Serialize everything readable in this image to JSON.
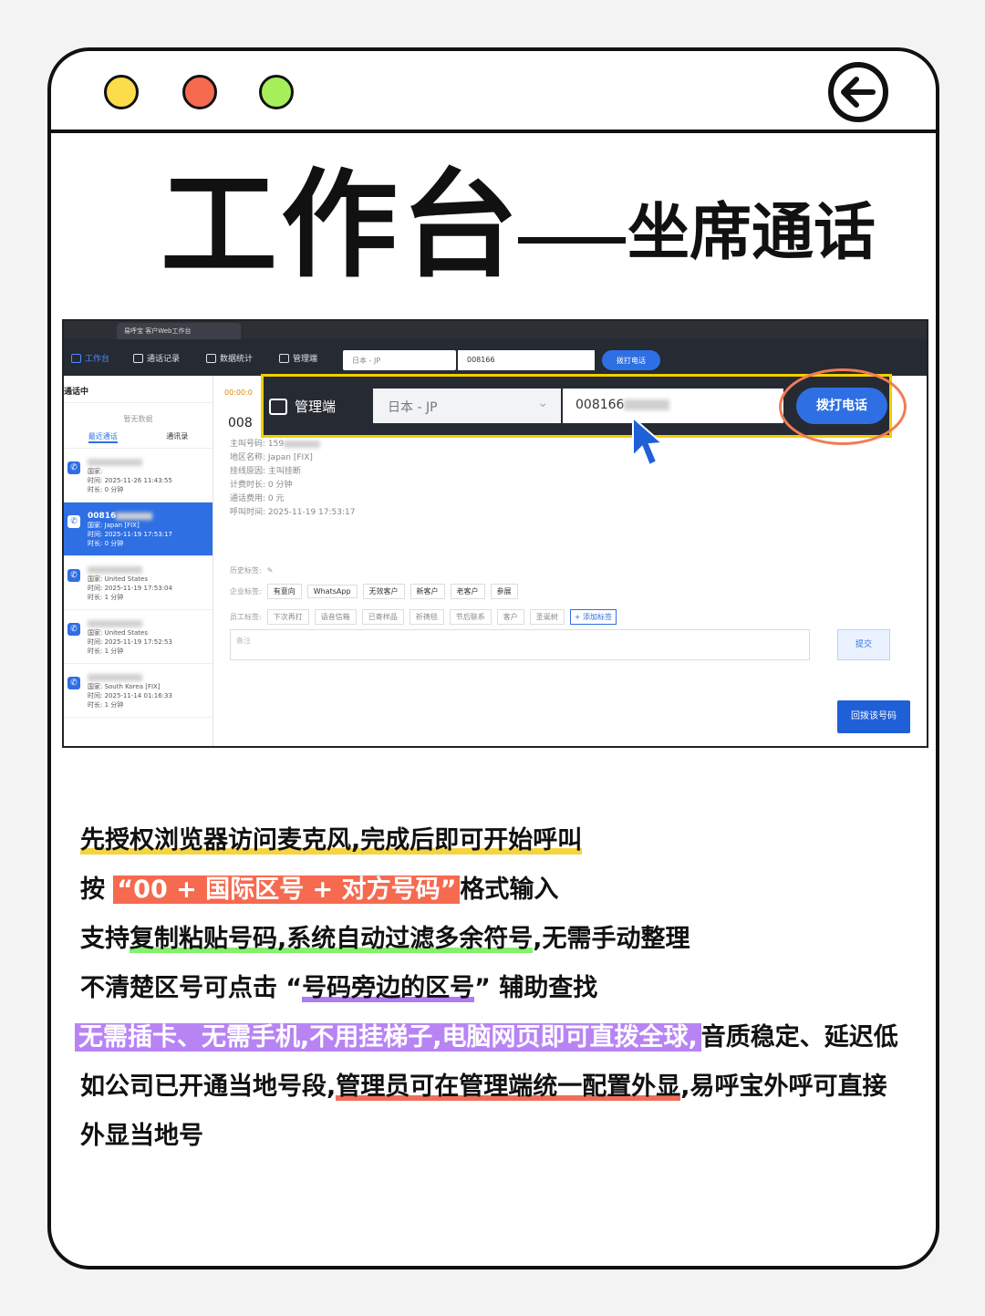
{
  "title": {
    "main": "工作台",
    "sub": "坐席通话"
  },
  "colors": {
    "dot1": "#fbdc4a",
    "dot2": "#f66a4f",
    "dot3": "#a6ef5a",
    "accent": "#2f6fe4"
  },
  "screenshot": {
    "browser_tab": "易呼宝 客户Web工作台",
    "nav": [
      "工作台",
      "通话记录",
      "数据统计",
      "管理端"
    ],
    "country_select": "日本 - JP",
    "dial_input": "008166",
    "dial_button": "拨打电话",
    "left": {
      "header": "通话中",
      "empty": "暂无数据",
      "tab_recent": "最近通话",
      "tab_contacts": "通讯录",
      "records": [
        {
          "num": "",
          "country": "国家:",
          "time": "时间: 2025-11-26 11:43:55",
          "dur": "时长: 0 分钟"
        },
        {
          "num": "00816",
          "country": "国家: Japan [FIX]",
          "time": "时间: 2025-11-19 17:53:17",
          "dur": "时长: 0 分钟"
        },
        {
          "num": "",
          "country": "国家: United States",
          "time": "时间: 2025-11-19 17:53:04",
          "dur": "时长: 1 分钟"
        },
        {
          "num": "",
          "country": "国家: United States",
          "time": "时间: 2025-11-19 17:52:53",
          "dur": "时长: 1 分钟"
        },
        {
          "num": "",
          "country": "国家: South Korea [FIX]",
          "time": "时间: 2025-11-14 01:16:33",
          "dur": "时长: 1 分钟"
        }
      ]
    },
    "detail": {
      "timer": "00:00:0",
      "number_prefix": "008",
      "caller": "主叫号码: 159",
      "region": "地区名称: Japan [FIX]",
      "reason": "挂线原因: 主叫挂断",
      "billing": "计费时长: 0 分钟",
      "fee": "通话费用: 0 元",
      "call_time": "呼叫时间: 2025-11-19 17:53:17"
    },
    "tags": {
      "history_label": "历史标签:",
      "company_label": "企业标签:",
      "company_tags": [
        "有意向",
        "WhatsApp",
        "无效客户",
        "新客户",
        "老客户",
        "参展"
      ],
      "staff_label": "员工标签:",
      "staff_tags": [
        "下次再打",
        "语音信箱",
        "已寄样品",
        "祈祷毯",
        "节后联系",
        "客户",
        "圣诞树"
      ],
      "add_tag": "+ 添加标签"
    },
    "remark_placeholder": "备注",
    "submit": "提交",
    "redial": "回拨该号码",
    "zoom": {
      "label": "管理端",
      "country": "日本 - JP",
      "number": "008166",
      "dial": "拨打电话"
    }
  },
  "lines": {
    "l1": "先授权浏览器访问麦克风,完成后即可开始呼叫",
    "l2a": "按 ",
    "l2b": "“00 + 国际区号 + 对方号码”",
    "l2c": "格式输入",
    "l3a": "支持",
    "l3b": "复制粘贴号码,系统自动过滤多余符号",
    "l3c": ",无需手动整理",
    "l4a": "不清楚区号可点击 “",
    "l4b": "号码旁边的区号",
    "l4c": "” 辅助查找",
    "l5a": "无需插卡、无需手机,不用挂梯子,电脑网页即可直拨全球,",
    "l5b": "音质稳定、延迟低",
    "l6a": "如公司已开通当地号段,",
    "l6b": "管理员可在管理端统一配置外显",
    "l6c": ",易呼宝外呼可直接",
    "l7": "外显当地号"
  }
}
